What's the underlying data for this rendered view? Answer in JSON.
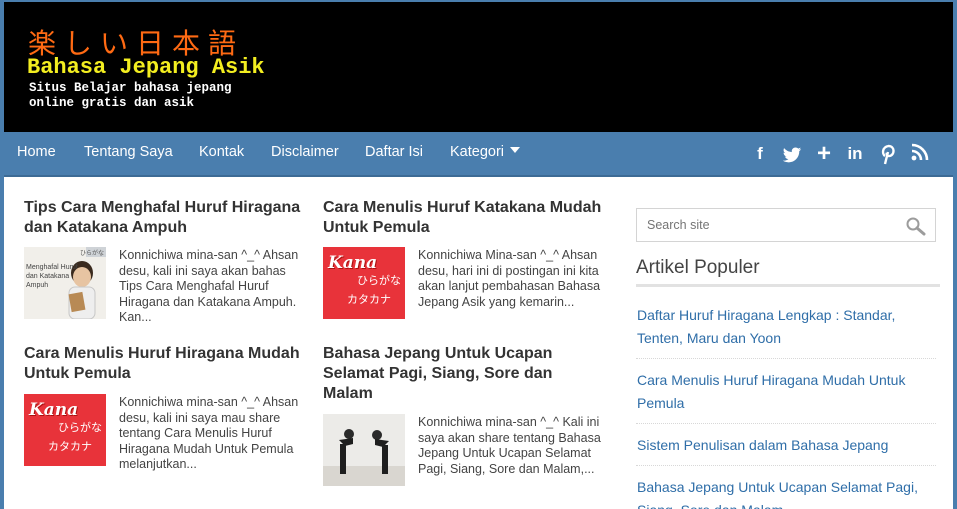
{
  "header": {
    "logo_jp": "楽しい日本語",
    "logo_title": "Bahasa Jepang Asik",
    "logo_desc": "Situs Belajar bahasa jepang online gratis dan asik"
  },
  "nav": {
    "items": [
      {
        "label": "Home"
      },
      {
        "label": "Tentang Saya"
      },
      {
        "label": "Kontak"
      },
      {
        "label": "Disclaimer"
      },
      {
        "label": "Daftar Isi"
      },
      {
        "label": "Kategori"
      }
    ],
    "social_icons": [
      "facebook-icon",
      "twitter-icon",
      "google-plus-icon",
      "linkedin-icon",
      "pinterest-icon",
      "rss-icon"
    ],
    "social_glyphs": [
      "f",
      "🐦",
      "+",
      "in",
      "P",
      "≈"
    ]
  },
  "posts": [
    {
      "title": "Tips Cara Menghafal Huruf Hiragana dan Katakana Ampuh",
      "snippet": "Konnichiwa mina-san ^_^ Ahsan desu, kali ini saya akan bahas Tips Cara Menghafal Huruf Hiragana dan Katakana Ampuh. Kan...",
      "thumb": {
        "line1": "Menghafal Huruf",
        "line2": "dan Katakana Ampuh",
        "corner": "ひらがな"
      }
    },
    {
      "title": "Cara Menulis Huruf Katakana Mudah Untuk Pemula",
      "snippet": "Konnichiwa Mina-san ^_^ Ahsan desu, hari ini di postingan ini kita akan lanjut pembahasan Bahasa Jepang Asik yang kemarin...",
      "thumb": {
        "kana_label": "Kana",
        "hiragana": "ひらがな",
        "katakana": "カタカナ"
      }
    },
    {
      "title": "Cara Menulis Huruf Hiragana Mudah Untuk Pemula",
      "snippet": "Konnichiwa mina-san ^_^ Ahsan desu, kali ini saya mau share tentang Cara Menulis Huruf Hiragana Mudah Untuk Pemula melanjutkan...",
      "thumb": {
        "kana_label": "Kana",
        "hiragana": "ひらがな",
        "katakana": "カタカナ"
      }
    },
    {
      "title": "Bahasa Jepang Untuk Ucapan Selamat Pagi, Siang, Sore dan Malam",
      "snippet": "Konnichiwa mina-san ^_^ Kali ini saya akan share tentang Bahasa Jepang Untuk Ucapan Selamat Pagi, Siang, Sore dan Malam,..."
    }
  ],
  "sidebar": {
    "search_placeholder": "Search site",
    "widget_title": "Artikel Populer",
    "popular": [
      {
        "label": "Daftar Huruf Hiragana Lengkap : Standar, Tenten, Maru dan Yoon"
      },
      {
        "label": "Cara Menulis Huruf Hiragana Mudah Untuk Pemula"
      },
      {
        "label": "Sistem Penulisan dalam Bahasa Jepang"
      },
      {
        "label": "Bahasa Jepang Untuk Ucapan Selamat Pagi, Siang, Sore dan Malam"
      }
    ]
  },
  "colors": {
    "nav_bg": "#4a7eae",
    "logo_jp": "#ff6a13",
    "logo_title": "#f3ee20",
    "link": "#2f6ea8",
    "kana_red": "#e8333a"
  }
}
